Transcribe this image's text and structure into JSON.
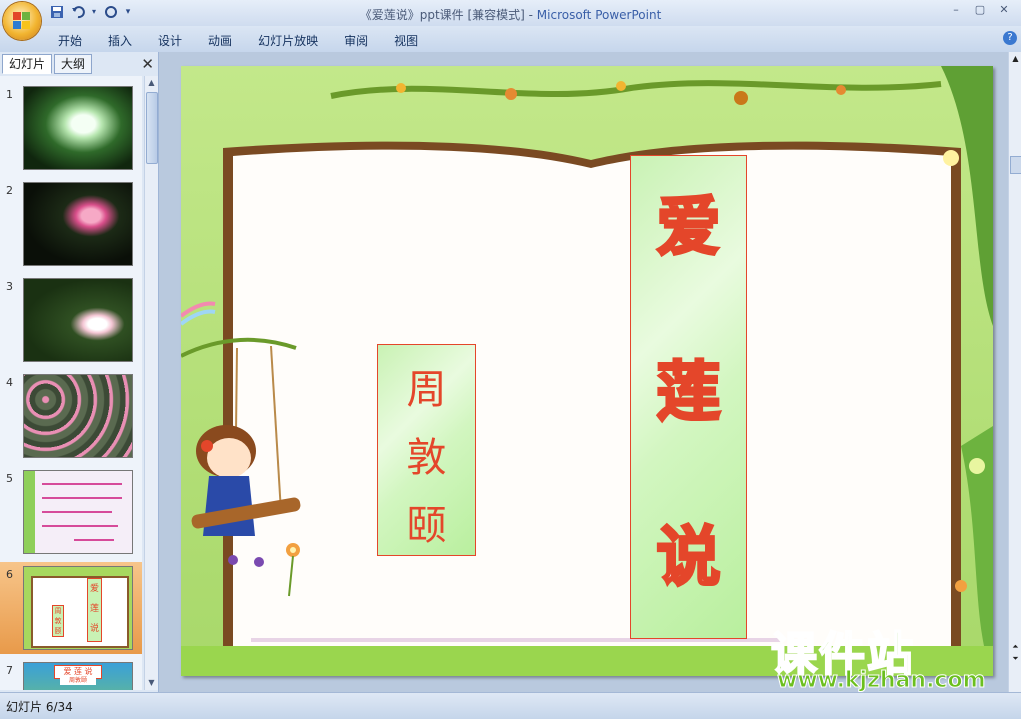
{
  "window": {
    "title_doc": "《爱莲说》ppt课件 [兼容模式] - ",
    "title_app": "Microsoft PowerPoint",
    "controls": [
      "–",
      "▢",
      "✕"
    ]
  },
  "qat": [
    "save-icon",
    "undo-icon",
    "redo-icon",
    "customize-icon"
  ],
  "ribbon": {
    "tabs": [
      "开始",
      "插入",
      "设计",
      "动画",
      "幻灯片放映",
      "审阅",
      "视图"
    ],
    "help": "?"
  },
  "pane": {
    "tab_slides": "幻灯片",
    "tab_outline": "大纲",
    "close": "✕"
  },
  "thumbnails": [
    {
      "num": "1"
    },
    {
      "num": "2"
    },
    {
      "num": "3"
    },
    {
      "num": "4"
    },
    {
      "num": "5"
    },
    {
      "num": "6",
      "selected": true
    },
    {
      "num": "7"
    }
  ],
  "thumb7": {
    "title": "爱 莲 说",
    "sub": "周敦颐"
  },
  "slide": {
    "author": [
      "周",
      "敦",
      "颐"
    ],
    "title": [
      "爱",
      "莲",
      "说"
    ],
    "mini_title": [
      "爱",
      "莲",
      "说"
    ],
    "mini_author": [
      "周",
      "敦",
      "颐"
    ]
  },
  "watermark": {
    "main": "课件站",
    "url": "www.kjzhan.com"
  },
  "status": {
    "slide_counter": "幻灯片 6/34"
  },
  "colors": {
    "accent_red": "#e4462a",
    "frame_green": "#9ad64e",
    "box_green": "#c9f2b4"
  }
}
